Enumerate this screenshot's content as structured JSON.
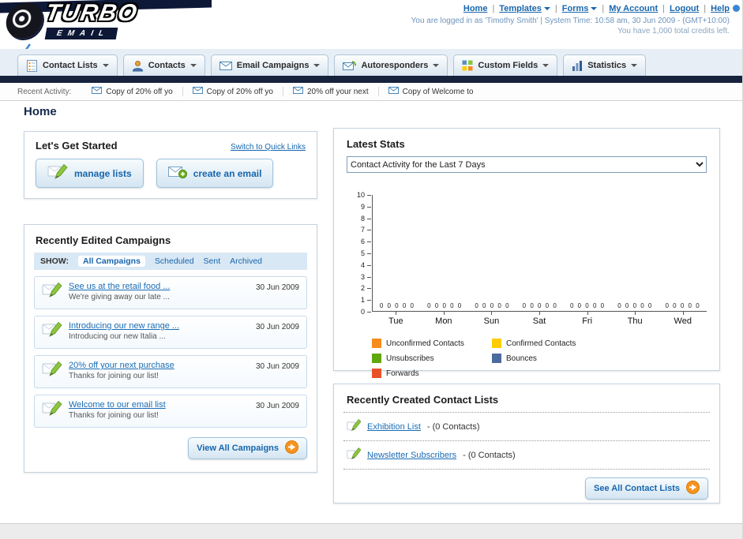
{
  "header": {
    "logo_top": "TURBO",
    "logo_bottom": "EMAIL",
    "nav": [
      {
        "label": "Home"
      },
      {
        "label": "Templates"
      },
      {
        "label": "Forms"
      },
      {
        "label": "My Account"
      },
      {
        "label": "Logout"
      },
      {
        "label": "Help"
      }
    ],
    "login_status": "You are logged in as 'Timothy Smith' | System Time: 10:58 am, 30 Jun 2009 - (GMT+10:00)",
    "credits": "You have 1,000 total credits left."
  },
  "tabs": [
    {
      "label": "Contact Lists",
      "icon": "contact-lists-icon"
    },
    {
      "label": "Contacts",
      "icon": "contacts-icon"
    },
    {
      "label": "Email Campaigns",
      "icon": "email-campaigns-icon"
    },
    {
      "label": "Autoresponders",
      "icon": "autoresponders-icon"
    },
    {
      "label": "Custom Fields",
      "icon": "custom-fields-icon"
    },
    {
      "label": "Statistics",
      "icon": "statistics-icon"
    }
  ],
  "activity": {
    "label": "Recent Activity:",
    "items": [
      "Copy of 20% off yo",
      "Copy of 20% off yo",
      "20% off your next",
      "Copy of Welcome to"
    ]
  },
  "page_title": "Home",
  "get_started": {
    "title": "Let's Get Started",
    "switch_link": "Switch to Quick Links",
    "manage_lists_label": "manage lists",
    "create_email_label": "create an email"
  },
  "campaigns": {
    "title": "Recently Edited Campaigns",
    "show_label": "SHOW:",
    "filters": [
      "All Campaigns",
      "Scheduled",
      "Sent",
      "Archived"
    ],
    "active_filter": "All Campaigns",
    "items": [
      {
        "title": "See us at the retail food ...",
        "subtitle": "We're giving away our late ...",
        "date": "30 Jun 2009"
      },
      {
        "title": "Introducing our new range ...",
        "subtitle": "Introducing our new Italia ...",
        "date": "30 Jun 2009"
      },
      {
        "title": "20% off your next purchase",
        "subtitle": "Thanks for joining our list!",
        "date": "30 Jun 2009"
      },
      {
        "title": "Welcome to our email list",
        "subtitle": "Thanks for joining our list!",
        "date": "30 Jun 2009"
      }
    ],
    "view_all_label": "View All Campaigns"
  },
  "stats": {
    "title": "Latest Stats",
    "dropdown_value": "Contact Activity for the Last 7 Days",
    "chart_data": {
      "type": "bar",
      "title": "Contact Activity for the Last 7 Days",
      "categories": [
        "Tue",
        "Mon",
        "Sun",
        "Sat",
        "Fri",
        "Thu",
        "Wed"
      ],
      "series": [
        {
          "name": "Unconfirmed Contacts",
          "color": "#f68b1f",
          "values": [
            0,
            0,
            0,
            0,
            0,
            0,
            0
          ]
        },
        {
          "name": "Confirmed Contacts",
          "color": "#ffcc00",
          "values": [
            0,
            0,
            0,
            0,
            0,
            0,
            0
          ]
        },
        {
          "name": "Unsubscribes",
          "color": "#62a60d",
          "values": [
            0,
            0,
            0,
            0,
            0,
            0,
            0
          ]
        },
        {
          "name": "Bounces",
          "color": "#4a6b9d",
          "values": [
            0,
            0,
            0,
            0,
            0,
            0,
            0
          ]
        },
        {
          "name": "Forwards",
          "color": "#e8502a",
          "values": [
            0,
            0,
            0,
            0,
            0,
            0,
            0
          ]
        }
      ],
      "ylim": [
        0,
        10
      ],
      "ytick_step": 1,
      "grid": false,
      "legend_position": "bottom",
      "value_labels_shown": true
    }
  },
  "contact_lists": {
    "title": "Recently Created Contact Lists",
    "items": [
      {
        "name": "Exhibition List",
        "suffix": "- (0 Contacts)"
      },
      {
        "name": "Newsletter Subscribers",
        "suffix": "- (0 Contacts)"
      }
    ],
    "see_all_label": "See All Contact Lists"
  }
}
